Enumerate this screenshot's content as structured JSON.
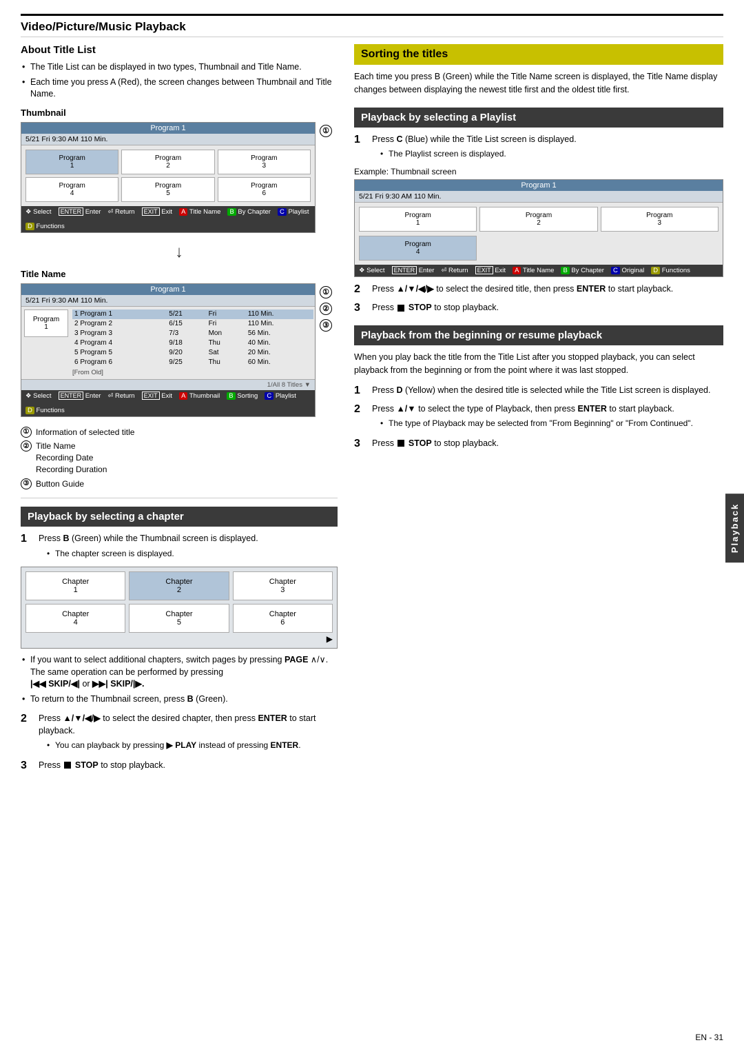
{
  "page": {
    "title": "Video/Picture/Music Playback",
    "page_number": "EN - 31"
  },
  "sidebar_tab": "Playback",
  "left_col": {
    "about_title_list": {
      "heading": "About Title List",
      "bullets": [
        "The Title List can be displayed in two types, Thumbnail and Title Name.",
        "Each time you press A (Red), the screen changes between Thumbnail and Title Name."
      ]
    },
    "thumbnail_section": {
      "heading": "Thumbnail",
      "screen": {
        "header": "Program 1",
        "subheader": "5/21   Fri  9:30 AM  110 Min.",
        "programs": [
          {
            "label": "Program",
            "num": "1",
            "active": true
          },
          {
            "label": "Program",
            "num": "2",
            "active": false
          },
          {
            "label": "Program",
            "num": "3",
            "active": false
          },
          {
            "label": "Program",
            "num": "4",
            "active": false
          },
          {
            "label": "Program",
            "num": "5",
            "active": false
          },
          {
            "label": "Program",
            "num": "6",
            "active": false
          }
        ],
        "footer": [
          {
            "icon": "◆",
            "label": "Select"
          },
          {
            "icon": "ENTER",
            "label": "Enter"
          },
          {
            "icon": "⏎",
            "label": "Return"
          },
          {
            "icon": "EXIT",
            "label": "Exit"
          },
          {
            "btn": "A",
            "label": "Title Name"
          },
          {
            "btn": "B",
            "label": "By Chapter"
          },
          {
            "btn": "C",
            "label": "Playlist"
          },
          {
            "btn": "D",
            "label": "Functions"
          }
        ]
      },
      "circle_1": "①"
    },
    "title_name_section": {
      "heading": "Title Name",
      "screen": {
        "header": "Program 1",
        "subheader": "5/21   Fri  9:30 AM  110 Min.",
        "thumb_label": "Program\n1",
        "rows": [
          {
            "num": "1",
            "name": "Program 1",
            "date": "5/21",
            "day": "Fri",
            "duration": "110 Min."
          },
          {
            "num": "2",
            "name": "Program 2",
            "date": "6/15",
            "day": "Fri",
            "duration": "110 Min."
          },
          {
            "num": "3",
            "name": "Program 3",
            "date": "7/3",
            "day": "Mon",
            "duration": "56 Min."
          },
          {
            "num": "4",
            "name": "Program 4",
            "date": "9/18",
            "day": "Thu",
            "duration": "40 Min."
          },
          {
            "num": "5",
            "name": "Program 5",
            "date": "9/20",
            "day": "Sat",
            "duration": "20 Min."
          },
          {
            "num": "6",
            "name": "Program 6",
            "date": "9/25",
            "day": "Thu",
            "duration": "60 Min."
          }
        ],
        "from_old_label": "[From Old]",
        "pagination": "1/All 8 Titles  ▼",
        "footer": [
          {
            "icon": "◆",
            "label": "Select"
          },
          {
            "icon": "ENTER",
            "label": "Enter"
          },
          {
            "icon": "⏎",
            "label": "Return"
          },
          {
            "icon": "EXIT",
            "label": "Exit"
          },
          {
            "btn": "A",
            "label": "Thumbnail"
          },
          {
            "btn": "B",
            "label": "Sorting"
          },
          {
            "btn": "C",
            "label": "Playlist"
          },
          {
            "btn": "D",
            "label": "Functions"
          }
        ]
      },
      "circle_1": "①",
      "circle_2": "②",
      "circle_3": "③"
    },
    "annotations": {
      "items": [
        {
          "num": "①",
          "text": "Information of selected title"
        },
        {
          "num": "②",
          "lines": [
            "Title Name",
            "Recording Date",
            "Recording Duration"
          ]
        },
        {
          "num": "③",
          "text": "Button Guide"
        }
      ]
    },
    "chapter_section": {
      "heading": "Playback by selecting a chapter",
      "steps": [
        {
          "num": "1",
          "main": "Press B (Green) while the Thumbnail screen is displayed.",
          "sub_bullets": [
            "The chapter screen is displayed."
          ]
        }
      ],
      "chapter_screen": {
        "chapters": [
          {
            "label": "Chapter",
            "num": "1",
            "active": false
          },
          {
            "label": "Chapter",
            "num": "2",
            "active": true
          },
          {
            "label": "Chapter",
            "num": "3",
            "active": false
          },
          {
            "label": "Chapter",
            "num": "4",
            "active": false
          },
          {
            "label": "Chapter",
            "num": "5",
            "active": false
          },
          {
            "label": "Chapter",
            "num": "6",
            "active": false
          }
        ]
      },
      "chapter_notes": [
        "If you want to select additional chapters, switch pages by pressing PAGE ∧/∨.",
        "The same operation can be performed by pressing",
        "|◀◀ SKIP/◀| or ▶▶| SKIP/|▶.",
        "To return to the Thumbnail screen, press B (Green)."
      ],
      "steps_continued": [
        {
          "num": "2",
          "main": "Press ▲/▼/◀/▶ to select the desired chapter, then press ENTER to start playback.",
          "sub_bullets": [
            "You can playback by pressing ▶ PLAY instead of pressing ENTER."
          ]
        },
        {
          "num": "3",
          "main": "Press ■ STOP to stop playback.",
          "sub_bullets": []
        }
      ]
    }
  },
  "right_col": {
    "sorting_section": {
      "heading": "Sorting the titles",
      "body": "Each time you press B (Green) while the Title Name screen is displayed, the Title Name display changes between displaying the newest title first and the oldest title first."
    },
    "playlist_section": {
      "heading": "Playback by selecting a Playlist",
      "steps": [
        {
          "num": "1",
          "main": "Press C (Blue) while the Title List screen is displayed.",
          "sub_bullets": [
            "The Playlist screen is displayed."
          ]
        }
      ],
      "example_label": "Example: Thumbnail screen",
      "playlist_screen": {
        "header": "Program 1",
        "subheader": "5/21   Fri  9:30 AM  110 Min.",
        "programs": [
          {
            "label": "Program",
            "num": "1",
            "active": false
          },
          {
            "label": "Program",
            "num": "2",
            "active": false
          },
          {
            "label": "Program",
            "num": "3",
            "active": false
          },
          {
            "label": "Program",
            "num": "4",
            "active": true
          }
        ],
        "footer": [
          {
            "icon": "◆",
            "label": "Select"
          },
          {
            "icon": "ENTER",
            "label": "Enter"
          },
          {
            "icon": "⏎",
            "label": "Return"
          },
          {
            "icon": "EXIT",
            "label": "Exit"
          },
          {
            "btn": "A",
            "label": "Title Name"
          },
          {
            "btn": "B",
            "label": "By Chapter"
          },
          {
            "btn": "C",
            "label": "Original"
          },
          {
            "btn": "D",
            "label": "Functions"
          }
        ]
      },
      "steps_continued": [
        {
          "num": "2",
          "main": "Press ▲/▼/◀/▶ to select the desired title, then press ENTER to start playback.",
          "sub_bullets": []
        },
        {
          "num": "3",
          "main": "Press ■ STOP to stop playback.",
          "sub_bullets": []
        }
      ]
    },
    "resume_section": {
      "heading": "Playback from the beginning or resume playback",
      "body": "When you play back the title from the Title List after you stopped playback, you can select playback from the beginning or from the point where it was last stopped.",
      "steps": [
        {
          "num": "1",
          "main": "Press D (Yellow) when the desired title is selected while the Title List screen is displayed.",
          "sub_bullets": []
        },
        {
          "num": "2",
          "main": "Press ▲/▼ to select the type of Playback, then press ENTER to start playback.",
          "sub_bullets": [
            "The type of Playback may be selected from \"From Beginning\" or \"From Continued\"."
          ]
        },
        {
          "num": "3",
          "main": "Press ■ STOP to stop playback.",
          "sub_bullets": []
        }
      ]
    }
  }
}
